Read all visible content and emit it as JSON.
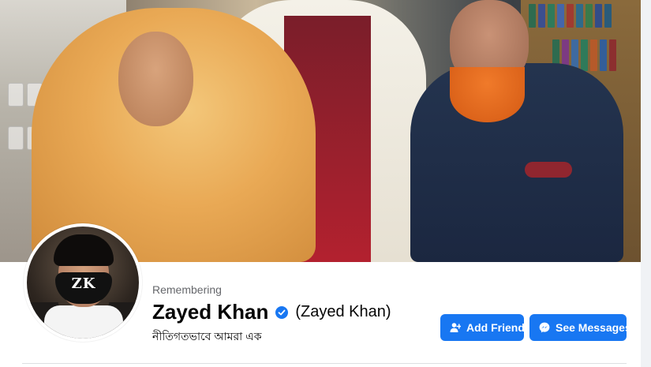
{
  "profile": {
    "status_label": "Remembering",
    "name": "Zayed Khan",
    "alternate_name": "(Zayed Khan)",
    "bio": "নীতিগতভাবে আমরা এক",
    "verified": true,
    "avatar_mask_text": "ZK"
  },
  "actions": {
    "add_friend_label": "Add Friend",
    "add_friend_icon": "add-user-icon",
    "see_messages_label": "See Messages",
    "see_messages_icon": "messenger-icon"
  },
  "colors": {
    "primary_button": "#1877f2",
    "verified_badge": "#1877f2",
    "secondary_text": "#65676b",
    "page_background": "#f0f2f5"
  }
}
